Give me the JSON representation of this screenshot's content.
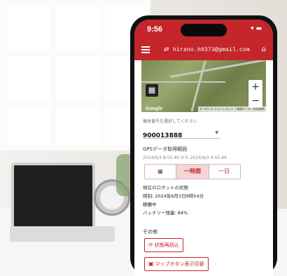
{
  "status_bar": {
    "time": "9:56",
    "icons": "wifi-battery"
  },
  "app_bar": {
    "menu_icon": "menu-icon",
    "user_icon": "user-switch-icon",
    "email": "hirano.h0373@gmail.com",
    "home_icon": "home-icon"
  },
  "map": {
    "logo": "Google",
    "attribution": "キーボード ショートカット | 地図データ | 利用規約",
    "zoom_in": "+",
    "zoom_out": "−",
    "layer_icon": "layers-icon"
  },
  "device": {
    "label": "機体番号を選択してください",
    "value": "900013888"
  },
  "gps": {
    "title": "GPSデータ取得範囲",
    "range": "2024/6/3 8:55:49 から 2024/6/3 9:55:49"
  },
  "range_buttons": {
    "calendar_icon": "calendar-icon",
    "hour": "一時間",
    "day": "一日"
  },
  "robot_status": {
    "title": "現在のロボットの状態",
    "time": "時刻: 2024年6月3日9時54分",
    "state": "稼働中",
    "battery": "バッテリー残量: 84%"
  },
  "other": {
    "title": "その他",
    "reload_label": "状態再読込",
    "map_button_label": "マップボタン表示切替"
  },
  "colors": {
    "primary": "#c4262c",
    "highlight": "#f4d6d7"
  }
}
